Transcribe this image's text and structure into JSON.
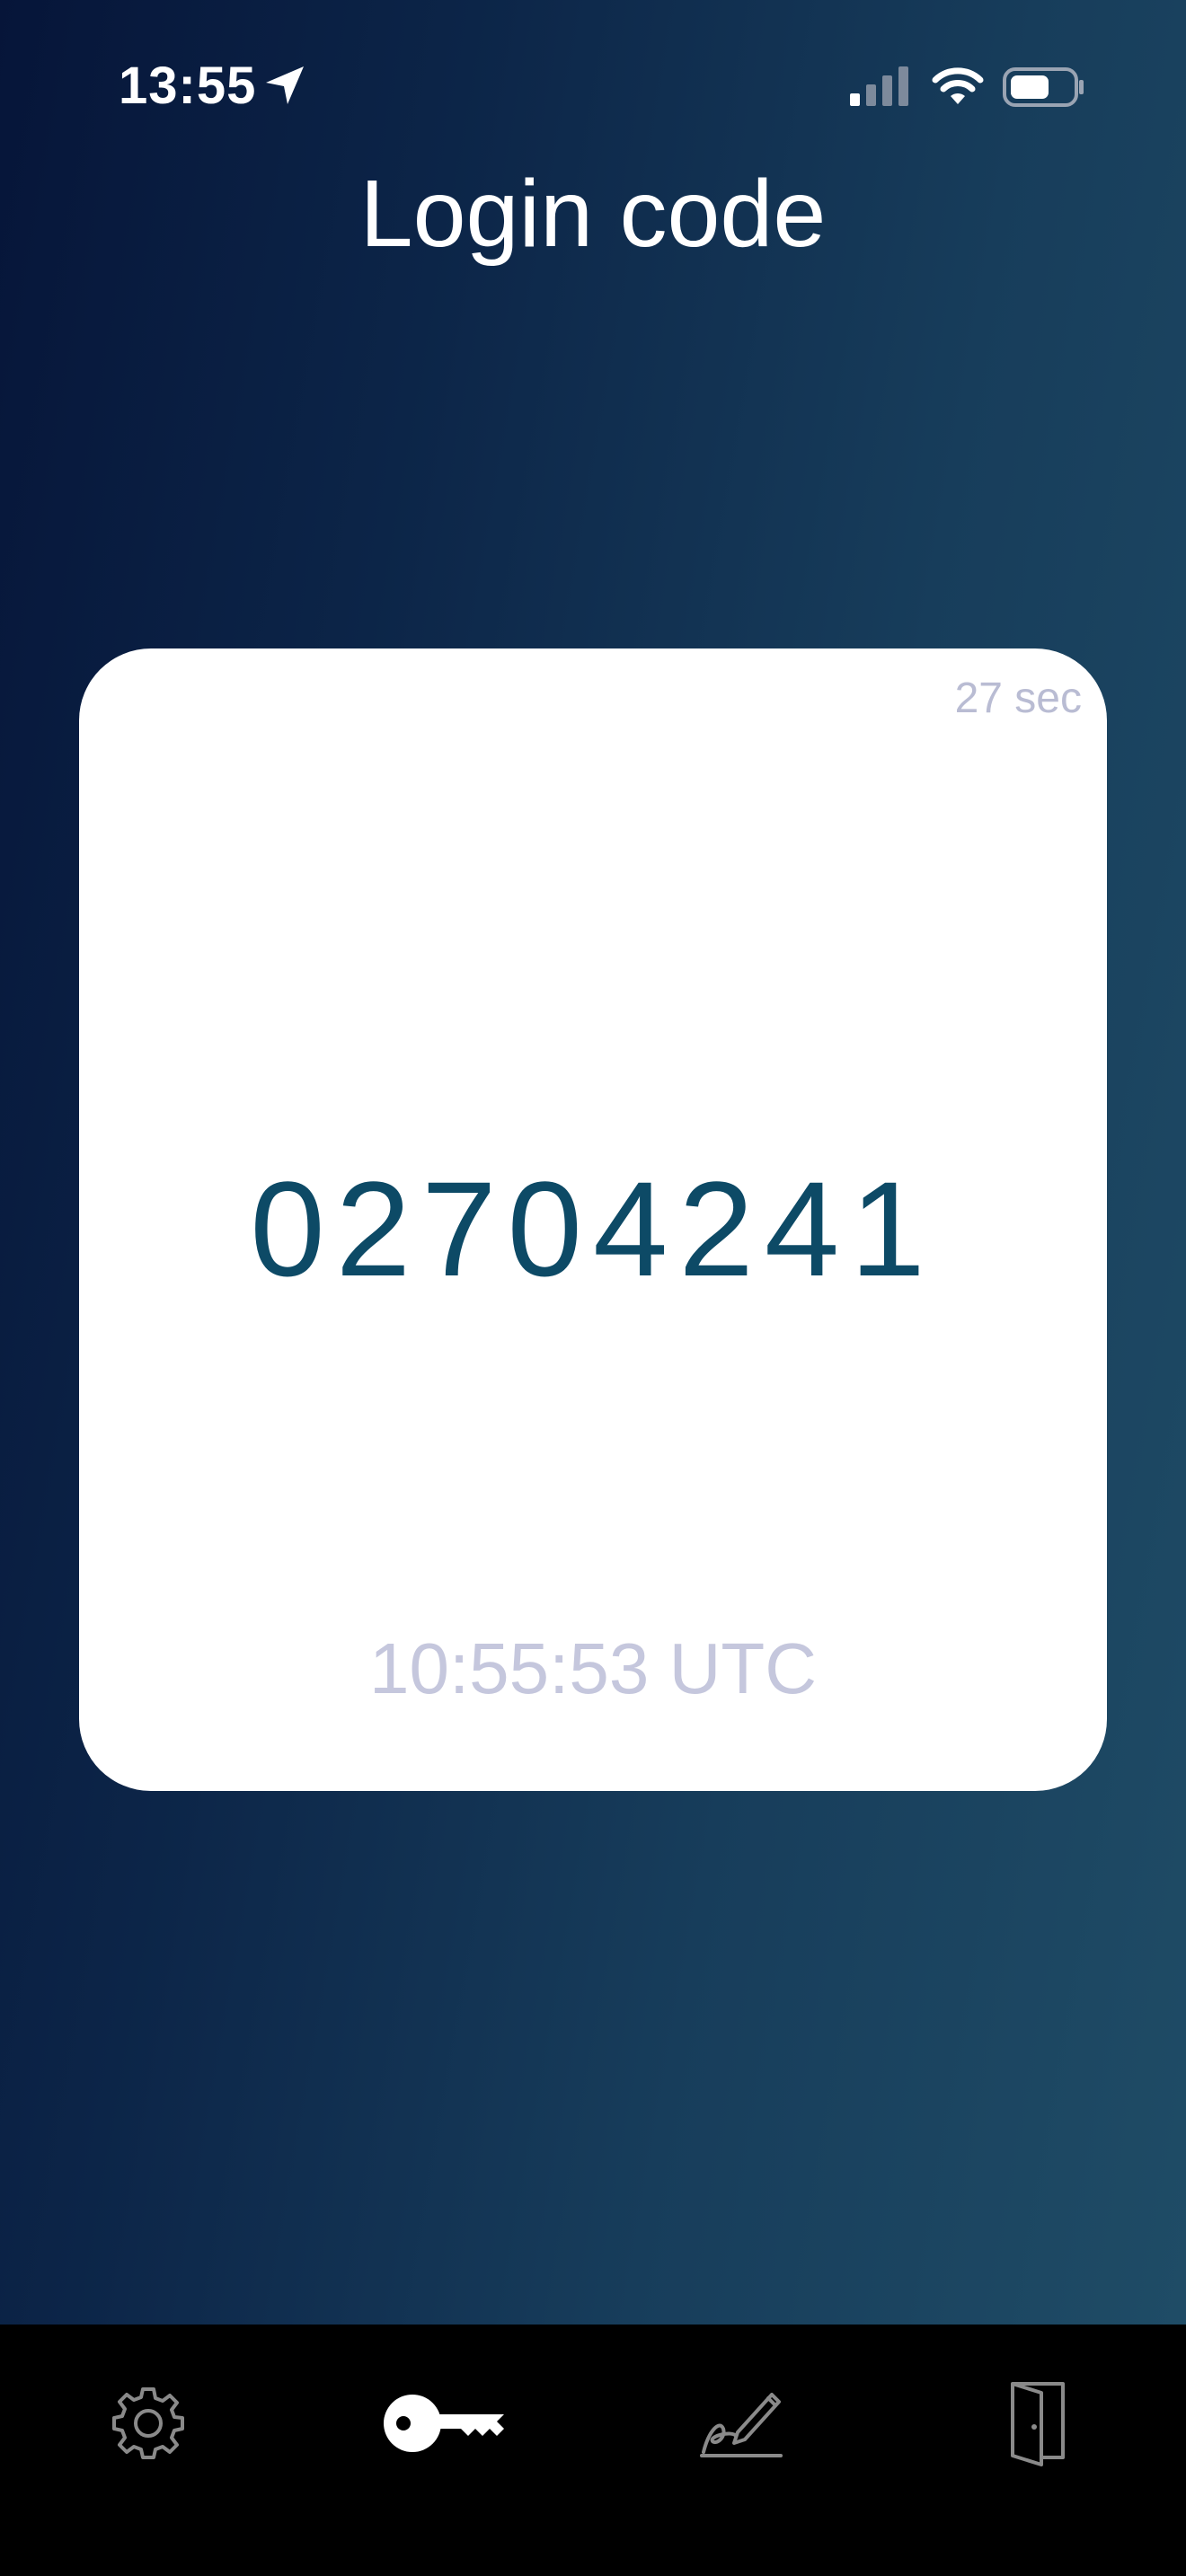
{
  "status_bar": {
    "time": "13:55",
    "icons": [
      "location-arrow-icon",
      "cellular-signal-icon",
      "wifi-icon",
      "battery-icon"
    ]
  },
  "header": {
    "title": "Login code"
  },
  "card": {
    "countdown": "27 sec",
    "code": "02704241",
    "utc_time": "10:55:53 UTC"
  },
  "tab_bar": {
    "tabs": [
      {
        "icon": "gear-icon",
        "active": false
      },
      {
        "icon": "key-icon",
        "active": true
      },
      {
        "icon": "signature-icon",
        "active": false
      },
      {
        "icon": "logout-door-icon",
        "active": false
      }
    ]
  },
  "colors": {
    "background_start": "#061539",
    "background_end": "#1f4c66",
    "code_text": "#0d4a66",
    "muted_text": "#b9bcd3",
    "tab_inactive": "#8a8a8a",
    "tab_active": "#ffffff"
  }
}
